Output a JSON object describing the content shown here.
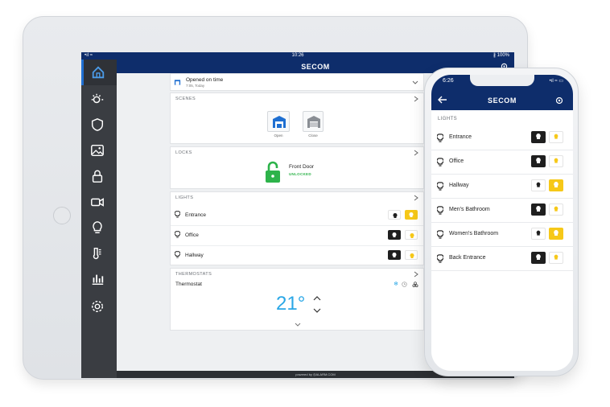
{
  "tablet": {
    "status": {
      "left": "•ıl ≈",
      "time": "10:26",
      "right": "∦ 100%"
    },
    "brand": "SECOM",
    "garage": {
      "title": "Opened on time",
      "subtitle": "7:05, Today"
    },
    "scenes": {
      "title": "SCENES",
      "items": [
        {
          "label": "Open"
        },
        {
          "label": "Close"
        }
      ]
    },
    "locks": {
      "title": "LOCKS",
      "name": "Front Door",
      "status": "UNLOCKED"
    },
    "lights": {
      "title": "LIGHTS",
      "items": [
        {
          "label": "Entrance",
          "state": "on"
        },
        {
          "label": "Office",
          "state": "off"
        },
        {
          "label": "Hallway",
          "state": "off"
        }
      ]
    },
    "thermostats": {
      "title": "THERMOSTATS",
      "name": "Thermostat",
      "temp": "21°"
    },
    "footer": "powered by ◎ALARM.COM"
  },
  "phone": {
    "time": "6:26",
    "status_right": "•ıl ≈ ▭",
    "brand": "SECOM",
    "section": "LIGHTS",
    "items": [
      {
        "label": "Entrance",
        "state": "off"
      },
      {
        "label": "Office",
        "state": "off"
      },
      {
        "label": "Hallway",
        "state": "on"
      },
      {
        "label": "Men's Bathroom",
        "state": "off"
      },
      {
        "label": "Women's Bathroom",
        "state": "on"
      },
      {
        "label": "Back Entrance",
        "state": "off"
      }
    ]
  },
  "colors": {
    "navy": "#0e2d6b",
    "sidebar": "#3a3d42",
    "yellow": "#f6c818",
    "green": "#2db34a",
    "blue": "#1f6fd1",
    "temp": "#2aa7e6"
  },
  "icons": [
    "home-icon",
    "sun-icon",
    "shield-icon",
    "image-icon",
    "lock-icon",
    "camera-icon",
    "bulb-icon",
    "thermometer-icon",
    "chart-icon",
    "gear-icon",
    "garage-icon",
    "snowflake-icon",
    "clock-icon",
    "fan-icon",
    "back-arrow-icon"
  ]
}
